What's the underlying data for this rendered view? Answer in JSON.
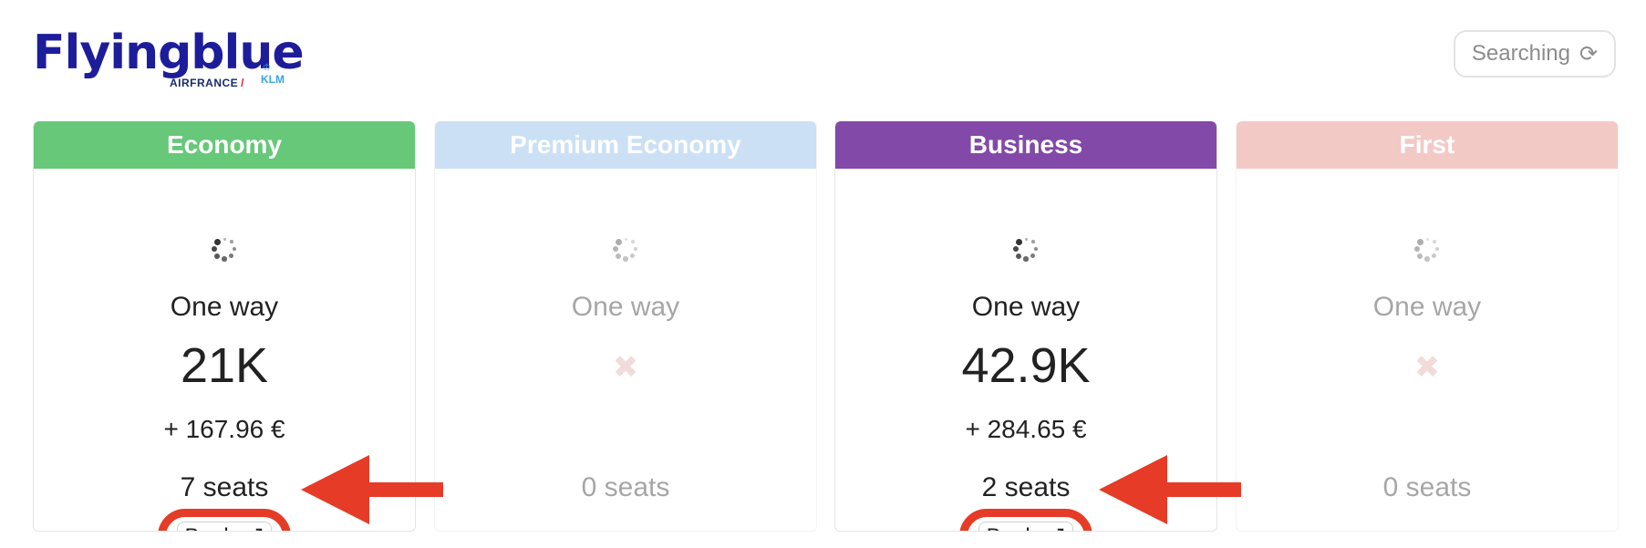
{
  "logo": {
    "wordmark": "Flyingblue",
    "partner_af": "AIRFRANCE",
    "partner_klm": "KLM"
  },
  "status": {
    "label": "Searching",
    "icon": "sync-icon"
  },
  "cabins": [
    {
      "name": "Economy",
      "color": "#66c878",
      "available": true,
      "fare_type": "One way",
      "miles": "21K",
      "taxes": "+ 167.96 €",
      "seats": "7 seats",
      "book_label": "Book"
    },
    {
      "name": "Premium Economy",
      "color": "#b9d4ef",
      "available": false,
      "fare_type": "One way",
      "miles": "",
      "taxes": "",
      "seats": "0 seats",
      "book_label": ""
    },
    {
      "name": "Business",
      "color": "#8249a8",
      "available": true,
      "fare_type": "One way",
      "miles": "42.9K",
      "taxes": "+ 284.65 €",
      "seats": "2 seats",
      "book_label": "Book"
    },
    {
      "name": "First",
      "color": "#efbcb7",
      "available": false,
      "fare_type": "One way",
      "miles": "",
      "taxes": "",
      "seats": "0 seats",
      "book_label": ""
    }
  ],
  "annotation_color": "#e53b27"
}
